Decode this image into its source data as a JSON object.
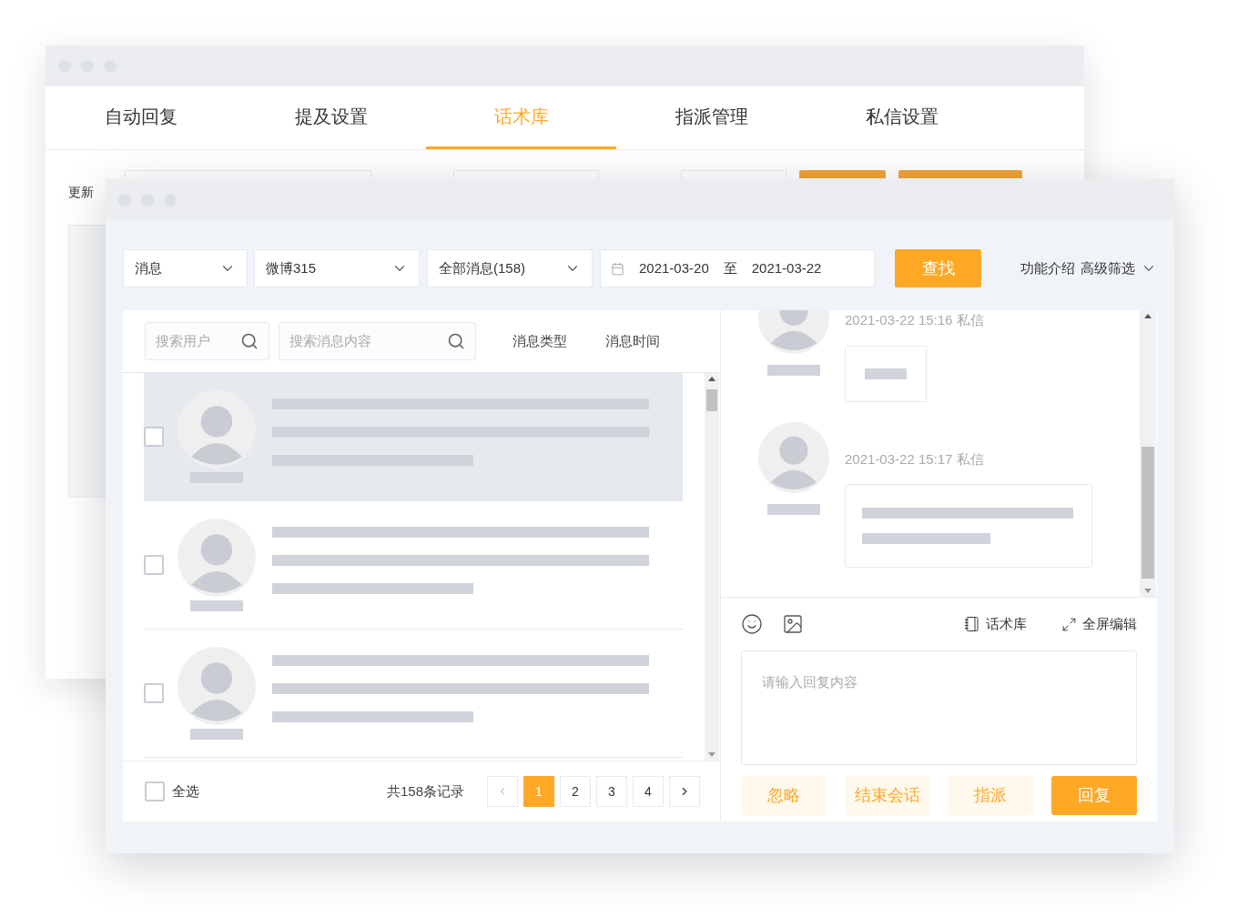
{
  "back_window": {
    "tabs": [
      {
        "label": "自动回复",
        "selected": false
      },
      {
        "label": "提及设置",
        "selected": false
      },
      {
        "label": "话术库",
        "selected": true
      },
      {
        "label": "指派管理",
        "selected": false
      },
      {
        "label": "私信设置",
        "selected": false
      }
    ],
    "filter_label": "更新"
  },
  "front_window": {
    "filters": {
      "type_select": "消息",
      "account_select": "微博315",
      "scope_select": "全部消息(158)",
      "date_from": "2021-03-20",
      "date_separator": "至",
      "date_to": "2021-03-22",
      "search_button": "查找",
      "links": [
        "功能介绍",
        "高级筛选"
      ]
    },
    "list": {
      "user_search": {
        "placeholder": "搜索用户"
      },
      "content_search": {
        "placeholder": "搜索消息内容"
      },
      "columns": [
        "消息类型",
        "消息时间"
      ],
      "rows": [
        {
          "selected": true,
          "checked": false
        },
        {
          "selected": false,
          "checked": false
        },
        {
          "selected": false,
          "checked": false
        }
      ],
      "select_all": {
        "label": "全选",
        "checked": false
      },
      "total": "共158条记录",
      "pagination": {
        "prev": {
          "disabled": true
        },
        "pages": [
          {
            "label": "1",
            "selected": true
          },
          {
            "label": "2",
            "selected": false
          },
          {
            "label": "3",
            "selected": false
          },
          {
            "label": "4",
            "selected": false
          }
        ],
        "next": {
          "disabled": false
        }
      }
    },
    "chat": {
      "messages": [
        {
          "time": "2021-03-22 15:16 私信",
          "kind": "short"
        },
        {
          "time": "2021-03-22 15:17 私信",
          "kind": "long"
        }
      ],
      "tools": [
        {
          "label": "话术库",
          "kind": "library"
        },
        {
          "label": "全屏编辑",
          "kind": "fullscreen"
        }
      ],
      "reply": {
        "placeholder": "请输入回复内容"
      },
      "actions": [
        {
          "label": "忽略",
          "kind": "secondary"
        },
        {
          "label": "结束会话",
          "kind": "secondary"
        },
        {
          "label": "指派",
          "kind": "secondary"
        },
        {
          "label": "回复",
          "kind": "primary"
        }
      ]
    }
  }
}
